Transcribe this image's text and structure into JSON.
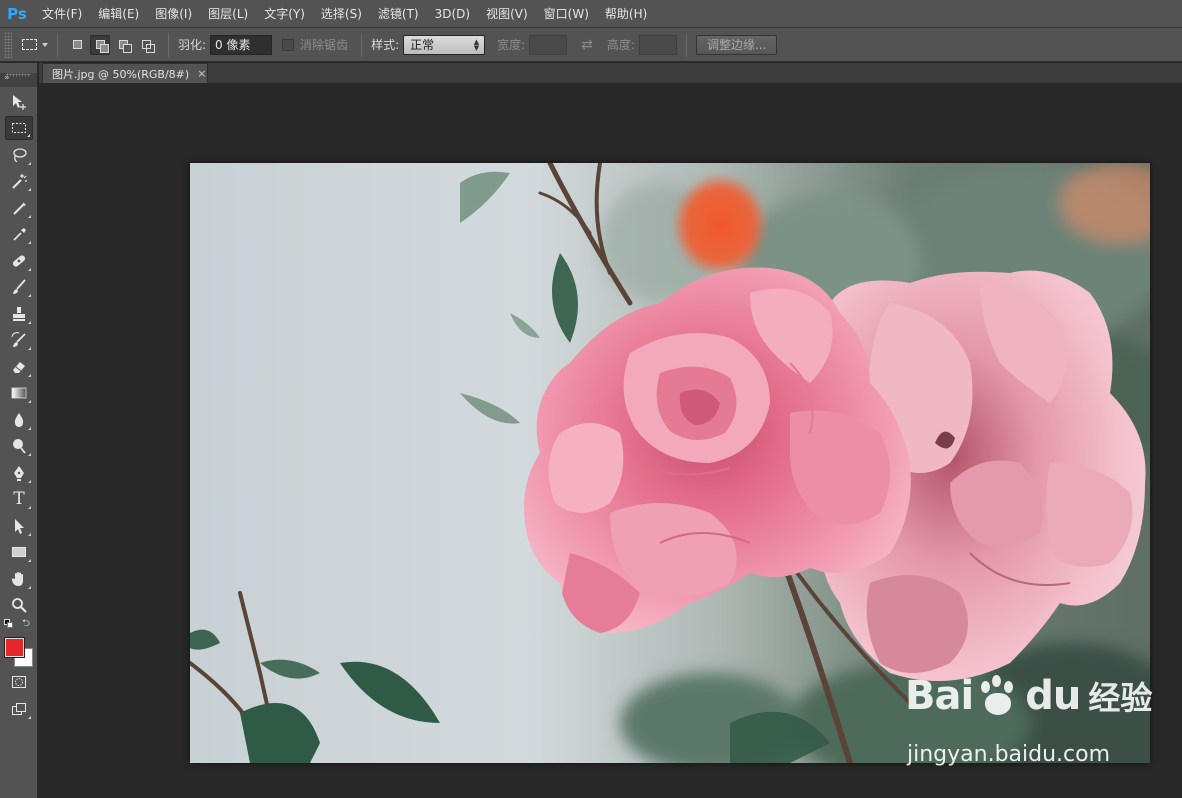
{
  "app": {
    "logo": "Ps",
    "accent_color": "#31a8ff"
  },
  "menu": [
    "文件(F)",
    "编辑(E)",
    "图像(I)",
    "图层(L)",
    "文字(Y)",
    "选择(S)",
    "滤镜(T)",
    "3D(D)",
    "视图(V)",
    "窗口(W)",
    "帮助(H)"
  ],
  "options": {
    "feather_label": "羽化:",
    "feather_value": "0 像素",
    "antialias_label": "消除锯齿",
    "style_label": "样式:",
    "style_value": "正常",
    "width_label": "宽度:",
    "height_label": "高度:",
    "refine_edge_button": "调整边缘..."
  },
  "document": {
    "tab_title": "图片.jpg @ 50%(RGB/8#)",
    "close_glyph": "×"
  },
  "tools": [
    {
      "name": "move-tool",
      "icon": "move-icon",
      "active": false
    },
    {
      "name": "rectangular-marquee-tool",
      "icon": "marquee-icon",
      "active": true
    },
    {
      "name": "lasso-tool",
      "icon": "lasso-icon",
      "active": false
    },
    {
      "name": "magic-wand-tool",
      "icon": "magic-wand-icon",
      "active": false
    },
    {
      "name": "crop-tool",
      "icon": "crop-icon",
      "active": false
    },
    {
      "name": "eyedropper-tool",
      "icon": "eyedropper-icon",
      "active": false
    },
    {
      "name": "healing-brush-tool",
      "icon": "bandage-icon",
      "active": false
    },
    {
      "name": "brush-tool",
      "icon": "brush-icon",
      "active": false
    },
    {
      "name": "clone-stamp-tool",
      "icon": "stamp-icon",
      "active": false
    },
    {
      "name": "history-brush-tool",
      "icon": "history-brush-icon",
      "active": false
    },
    {
      "name": "eraser-tool",
      "icon": "eraser-icon",
      "active": false
    },
    {
      "name": "gradient-tool",
      "icon": "gradient-icon",
      "active": false
    },
    {
      "name": "blur-tool",
      "icon": "drop-icon",
      "active": false
    },
    {
      "name": "dodge-tool",
      "icon": "dodge-icon",
      "active": false
    },
    {
      "name": "pen-tool",
      "icon": "pen-icon",
      "active": false
    },
    {
      "name": "type-tool",
      "icon": "type-icon",
      "active": false
    },
    {
      "name": "path-selection-tool",
      "icon": "arrow-icon",
      "active": false
    },
    {
      "name": "rectangle-tool",
      "icon": "rectangle-icon",
      "active": false
    },
    {
      "name": "hand-tool",
      "icon": "hand-icon",
      "active": false
    },
    {
      "name": "zoom-tool",
      "icon": "zoom-icon",
      "active": false
    }
  ],
  "type_tool_glyph": "T",
  "colors": {
    "foreground": "#e8262a",
    "background": "#ffffff"
  },
  "watermark": {
    "brand_bai": "Bai",
    "brand_du": "du",
    "brand_jingyan": "经验",
    "url": "jingyan.baidu.com"
  }
}
